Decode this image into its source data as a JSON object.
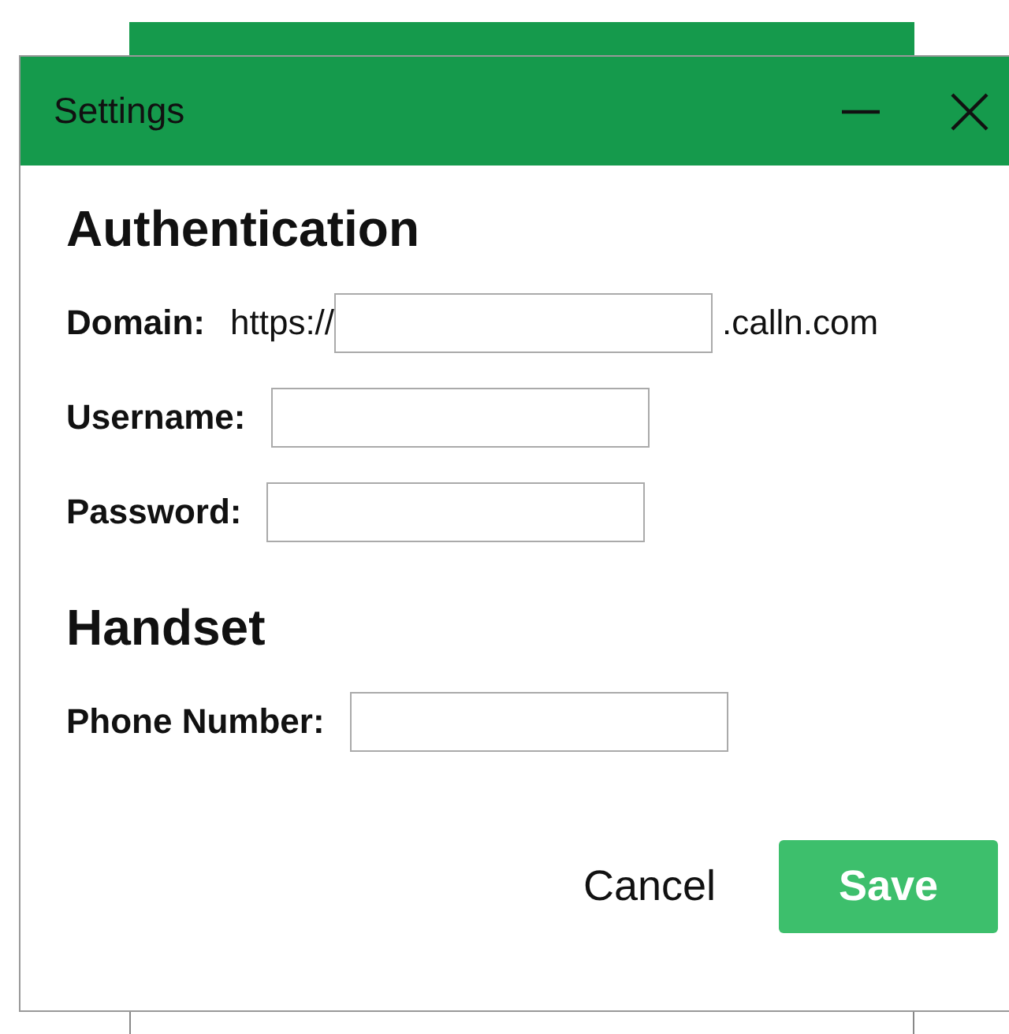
{
  "window": {
    "title": "Settings"
  },
  "sections": [
    {
      "heading": "Authentication",
      "fields": [
        {
          "label": "Domain:",
          "prefix": "https://",
          "suffix": ".calln.com"
        },
        {
          "label": "Username:"
        },
        {
          "label": "Password:"
        }
      ]
    },
    {
      "heading": "Handset",
      "fields": [
        {
          "label": "Phone Number:"
        }
      ]
    }
  ],
  "buttons": [
    {
      "label": "Cancel",
      "kind": "flat"
    },
    {
      "label": "Save",
      "kind": "primary"
    }
  ]
}
